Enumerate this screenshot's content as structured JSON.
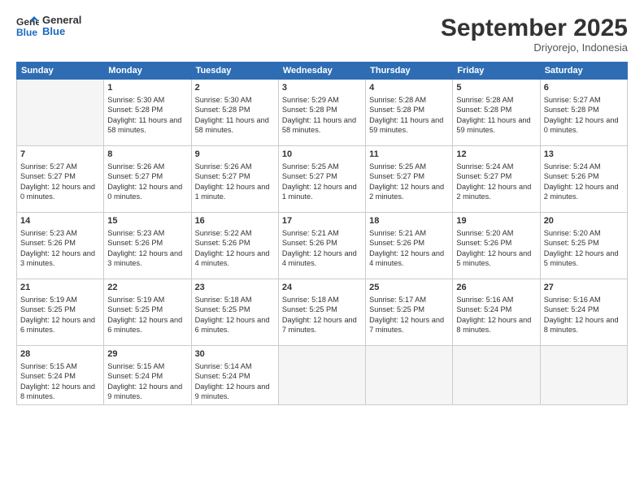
{
  "logo": {
    "line1": "General",
    "line2": "Blue"
  },
  "header": {
    "month": "September 2025",
    "location": "Driyorejo, Indonesia"
  },
  "weekdays": [
    "Sunday",
    "Monday",
    "Tuesday",
    "Wednesday",
    "Thursday",
    "Friday",
    "Saturday"
  ],
  "weeks": [
    [
      {
        "day": null
      },
      {
        "day": 1,
        "sunrise": "5:30 AM",
        "sunset": "5:28 PM",
        "daylight": "11 hours and 58 minutes."
      },
      {
        "day": 2,
        "sunrise": "5:30 AM",
        "sunset": "5:28 PM",
        "daylight": "11 hours and 58 minutes."
      },
      {
        "day": 3,
        "sunrise": "5:29 AM",
        "sunset": "5:28 PM",
        "daylight": "11 hours and 58 minutes."
      },
      {
        "day": 4,
        "sunrise": "5:28 AM",
        "sunset": "5:28 PM",
        "daylight": "11 hours and 59 minutes."
      },
      {
        "day": 5,
        "sunrise": "5:28 AM",
        "sunset": "5:28 PM",
        "daylight": "11 hours and 59 minutes."
      },
      {
        "day": 6,
        "sunrise": "5:27 AM",
        "sunset": "5:28 PM",
        "daylight": "12 hours and 0 minutes."
      }
    ],
    [
      {
        "day": 7,
        "sunrise": "5:27 AM",
        "sunset": "5:27 PM",
        "daylight": "12 hours and 0 minutes."
      },
      {
        "day": 8,
        "sunrise": "5:26 AM",
        "sunset": "5:27 PM",
        "daylight": "12 hours and 0 minutes."
      },
      {
        "day": 9,
        "sunrise": "5:26 AM",
        "sunset": "5:27 PM",
        "daylight": "12 hours and 1 minute."
      },
      {
        "day": 10,
        "sunrise": "5:25 AM",
        "sunset": "5:27 PM",
        "daylight": "12 hours and 1 minute."
      },
      {
        "day": 11,
        "sunrise": "5:25 AM",
        "sunset": "5:27 PM",
        "daylight": "12 hours and 2 minutes."
      },
      {
        "day": 12,
        "sunrise": "5:24 AM",
        "sunset": "5:27 PM",
        "daylight": "12 hours and 2 minutes."
      },
      {
        "day": 13,
        "sunrise": "5:24 AM",
        "sunset": "5:26 PM",
        "daylight": "12 hours and 2 minutes."
      }
    ],
    [
      {
        "day": 14,
        "sunrise": "5:23 AM",
        "sunset": "5:26 PM",
        "daylight": "12 hours and 3 minutes."
      },
      {
        "day": 15,
        "sunrise": "5:23 AM",
        "sunset": "5:26 PM",
        "daylight": "12 hours and 3 minutes."
      },
      {
        "day": 16,
        "sunrise": "5:22 AM",
        "sunset": "5:26 PM",
        "daylight": "12 hours and 4 minutes."
      },
      {
        "day": 17,
        "sunrise": "5:21 AM",
        "sunset": "5:26 PM",
        "daylight": "12 hours and 4 minutes."
      },
      {
        "day": 18,
        "sunrise": "5:21 AM",
        "sunset": "5:26 PM",
        "daylight": "12 hours and 4 minutes."
      },
      {
        "day": 19,
        "sunrise": "5:20 AM",
        "sunset": "5:26 PM",
        "daylight": "12 hours and 5 minutes."
      },
      {
        "day": 20,
        "sunrise": "5:20 AM",
        "sunset": "5:25 PM",
        "daylight": "12 hours and 5 minutes."
      }
    ],
    [
      {
        "day": 21,
        "sunrise": "5:19 AM",
        "sunset": "5:25 PM",
        "daylight": "12 hours and 6 minutes."
      },
      {
        "day": 22,
        "sunrise": "5:19 AM",
        "sunset": "5:25 PM",
        "daylight": "12 hours and 6 minutes."
      },
      {
        "day": 23,
        "sunrise": "5:18 AM",
        "sunset": "5:25 PM",
        "daylight": "12 hours and 6 minutes."
      },
      {
        "day": 24,
        "sunrise": "5:18 AM",
        "sunset": "5:25 PM",
        "daylight": "12 hours and 7 minutes."
      },
      {
        "day": 25,
        "sunrise": "5:17 AM",
        "sunset": "5:25 PM",
        "daylight": "12 hours and 7 minutes."
      },
      {
        "day": 26,
        "sunrise": "5:16 AM",
        "sunset": "5:24 PM",
        "daylight": "12 hours and 8 minutes."
      },
      {
        "day": 27,
        "sunrise": "5:16 AM",
        "sunset": "5:24 PM",
        "daylight": "12 hours and 8 minutes."
      }
    ],
    [
      {
        "day": 28,
        "sunrise": "5:15 AM",
        "sunset": "5:24 PM",
        "daylight": "12 hours and 8 minutes."
      },
      {
        "day": 29,
        "sunrise": "5:15 AM",
        "sunset": "5:24 PM",
        "daylight": "12 hours and 9 minutes."
      },
      {
        "day": 30,
        "sunrise": "5:14 AM",
        "sunset": "5:24 PM",
        "daylight": "12 hours and 9 minutes."
      },
      {
        "day": null
      },
      {
        "day": null
      },
      {
        "day": null
      },
      {
        "day": null
      }
    ]
  ]
}
